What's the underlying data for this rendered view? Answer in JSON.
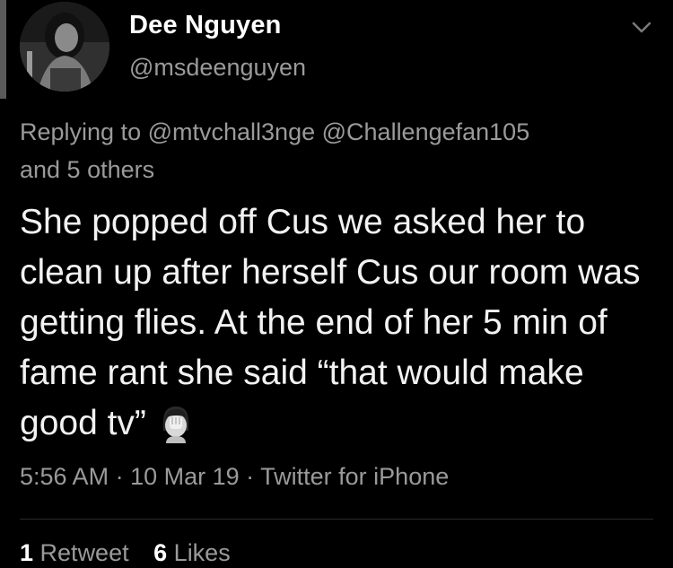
{
  "author": {
    "display_name": "Dee Nguyen",
    "handle": "@msdeenguyen"
  },
  "reply": {
    "prefix": "Replying to",
    "mention_1": "@mtvchall3nge",
    "mention_2": "@Challengefan105",
    "others": "and 5 others"
  },
  "tweet": {
    "text": "She popped off Cus we asked her to clean up after herself Cus our room was getting flies. At the end of her 5 min of fame rant she said “that would make good tv”",
    "emoji_icon": "face-palm-emoji-icon"
  },
  "meta": {
    "time": "5:56 AM",
    "date": "10 Mar 19",
    "source": "Twitter for iPhone",
    "separator": " · "
  },
  "stats": {
    "retweets_count": "1",
    "retweets_label": "Retweet",
    "likes_count": "6",
    "likes_label": "Likes"
  },
  "colors": {
    "background": "#000000",
    "primary_text": "#f2f2f2",
    "secondary_text": "#9a9a9a"
  }
}
